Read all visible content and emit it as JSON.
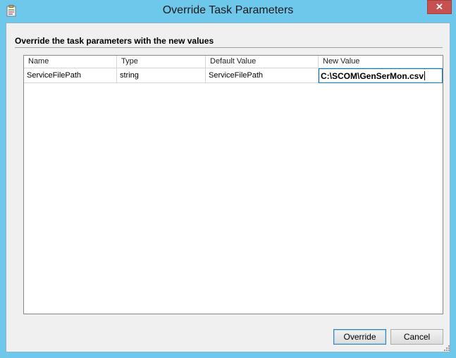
{
  "window": {
    "title": "Override Task Parameters",
    "close_label": "✕"
  },
  "instruction": "Override the task parameters with the new values",
  "table": {
    "columns": [
      "Name",
      "Type",
      "Default Value",
      "New Value"
    ],
    "rows": [
      {
        "name": "ServiceFilePath",
        "type": "string",
        "default_value": "ServiceFilePath",
        "new_value": "C:\\SCOM\\GenSerMon.csv"
      }
    ]
  },
  "buttons": {
    "override": "Override",
    "cancel": "Cancel"
  },
  "colors": {
    "title_bar": "#6ec8ec",
    "close_button": "#c75050",
    "dialog_background": "#f0f0f0",
    "edit_border": "#0078d7"
  },
  "icons": {
    "app": "task-clipboard-icon",
    "close": "close-icon",
    "resize": "resize-grip-icon"
  }
}
